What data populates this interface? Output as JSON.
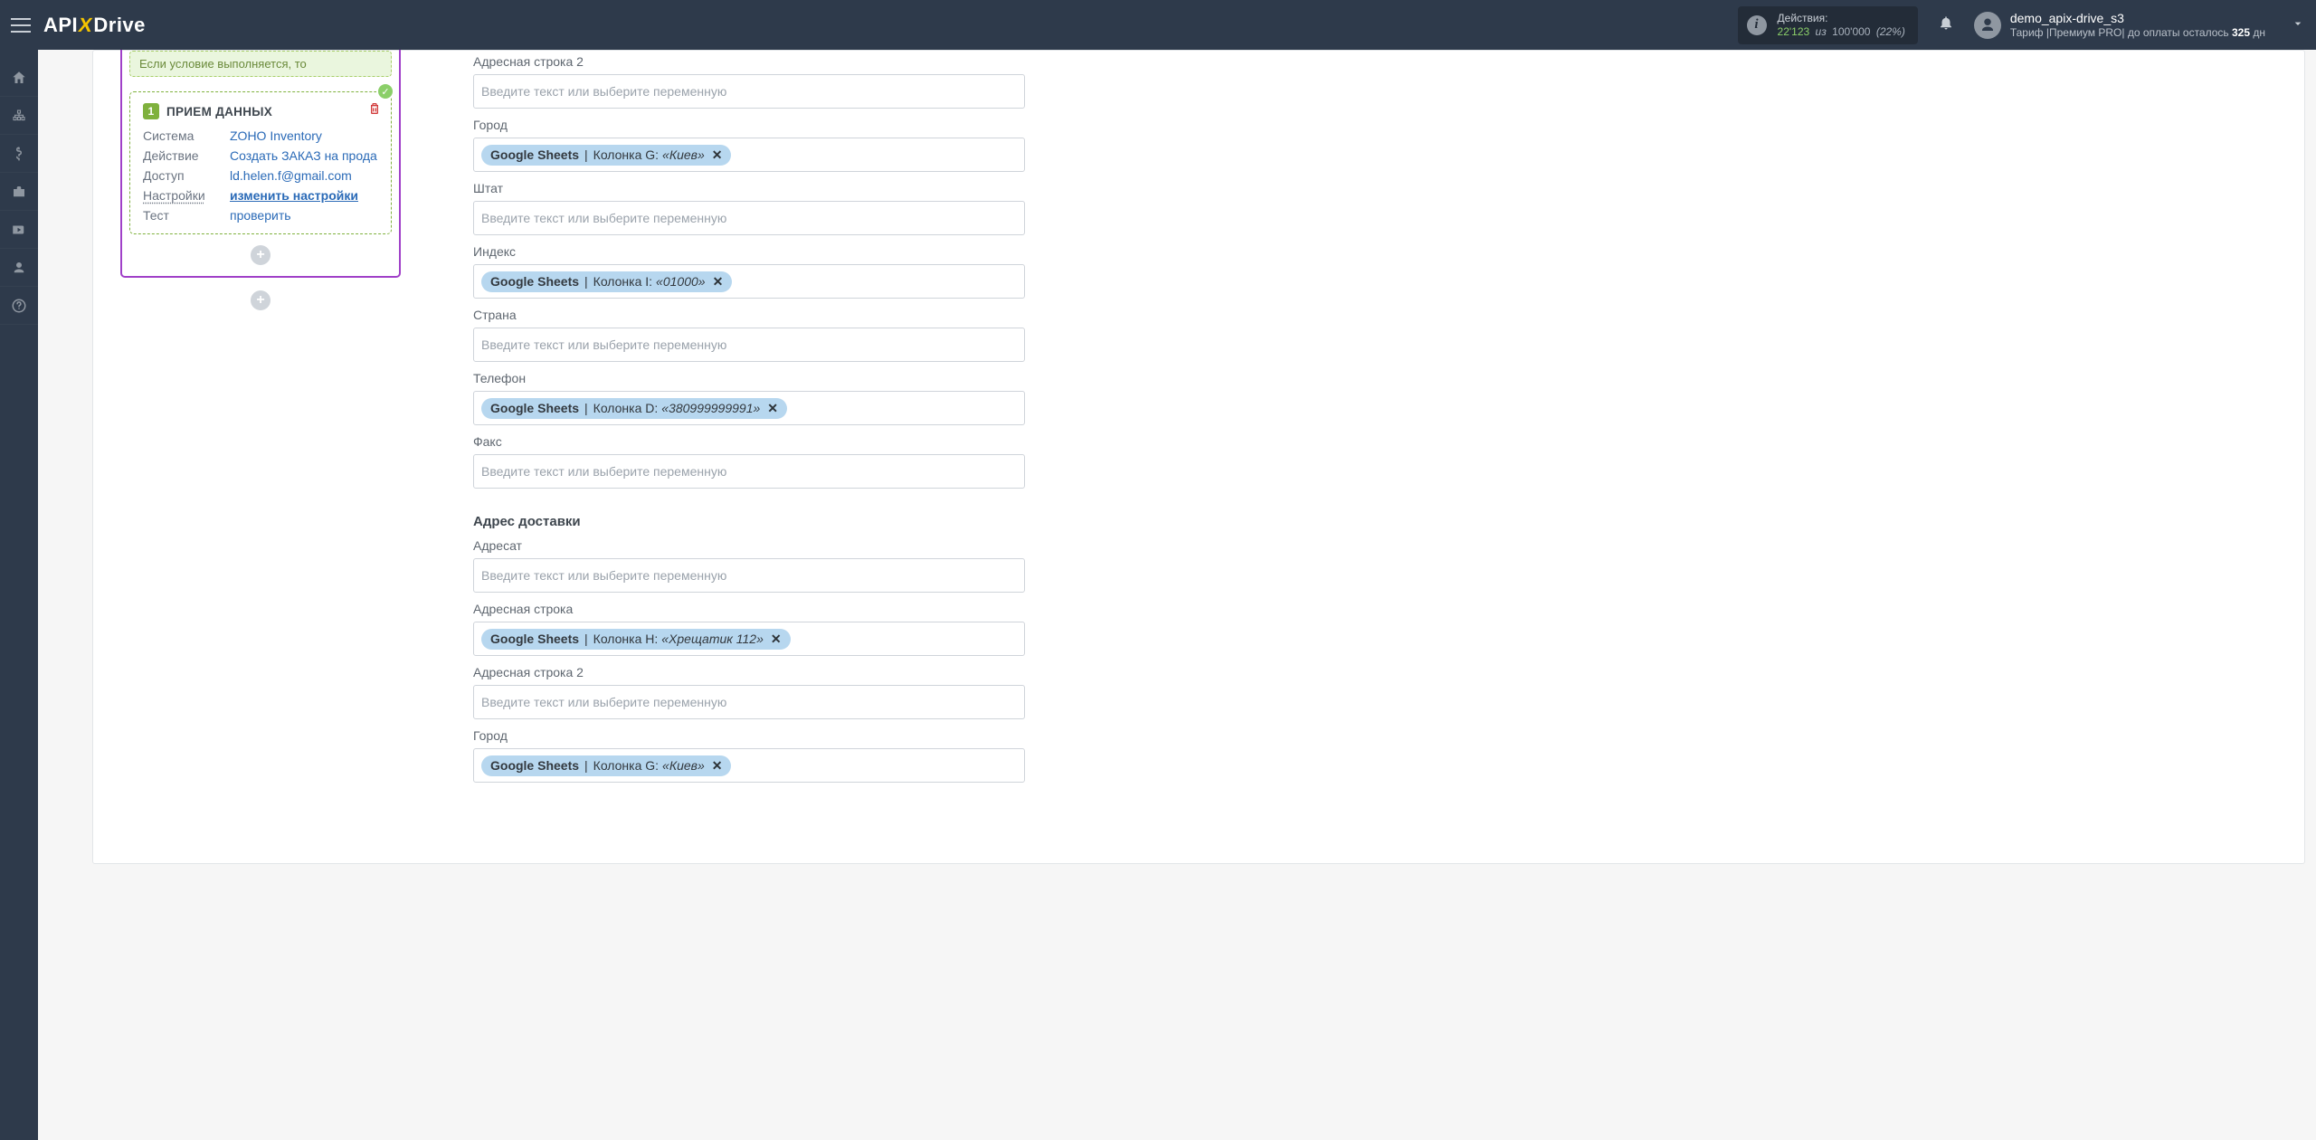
{
  "header": {
    "logo_prefix": "API",
    "logo_x": "X",
    "logo_suffix": "Drive",
    "actions_label": "Действия:",
    "actions_used": "22'123",
    "actions_iz": "из",
    "actions_total": "100'000",
    "actions_pct": "(22%)",
    "user_name": "demo_apix-drive_s3",
    "tariff_prefix": "Тариф |Премиум PRO| до оплаты осталось ",
    "tariff_days": "325",
    "tariff_suffix": " дн"
  },
  "workflow": {
    "condition_text": "Если условие выполняется, то",
    "block": {
      "badge": "1",
      "title": "ПРИЕМ ДАННЫХ",
      "rows": {
        "system_k": "Система",
        "system_v": "ZOHO Inventory",
        "action_k": "Действие",
        "action_v": "Создать ЗАКАЗ на прода",
        "access_k": "Доступ",
        "access_v": "ld.helen.f@gmail.com",
        "settings_k": "Настройки",
        "settings_v": "изменить настройки",
        "test_k": "Тест",
        "test_v": "проверить"
      }
    }
  },
  "form": {
    "placeholder": "Введите текст или выберите переменную",
    "addr2_label": "Адресная строка 2",
    "city_label": "Город",
    "city_chip": {
      "src": "Google Sheets",
      "col": "Колонка G:",
      "val": "«Киев»"
    },
    "state_label": "Штат",
    "index_label": "Индекс",
    "index_chip": {
      "src": "Google Sheets",
      "col": "Колонка I:",
      "val": "«01000»"
    },
    "country_label": "Страна",
    "phone_label": "Телефон",
    "phone_chip": {
      "src": "Google Sheets",
      "col": "Колонка D:",
      "val": "«380999999991»"
    },
    "fax_label": "Факс",
    "section_shipping": "Адрес доставки",
    "ship_to_label": "Адресат",
    "ship_addr_label": "Адресная строка",
    "ship_addr_chip": {
      "src": "Google Sheets",
      "col": "Колонка H:",
      "val": "«Хрещатик 112»"
    },
    "ship_addr2_label": "Адресная строка 2",
    "ship_city_label": "Город",
    "ship_city_chip": {
      "src": "Google Sheets",
      "col": "Колонка G:",
      "val": "«Киев»"
    }
  }
}
